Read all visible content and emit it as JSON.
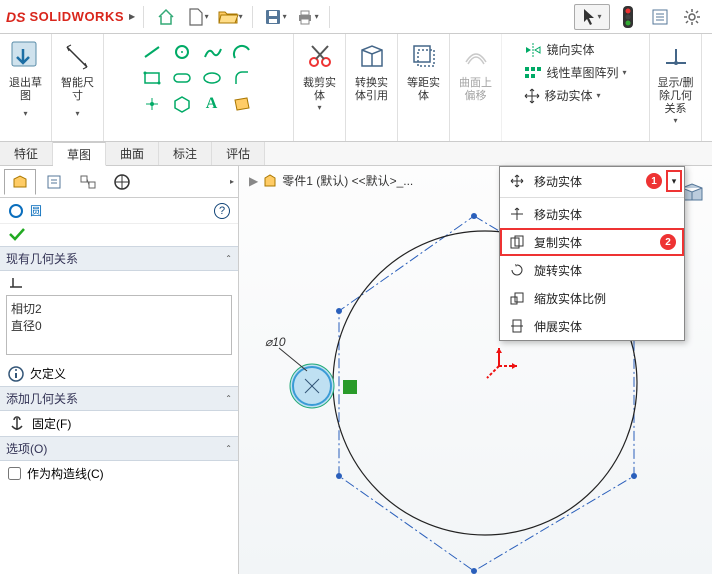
{
  "app": {
    "name": "SOLIDWORKS"
  },
  "ribbon": {
    "exit_sketch": "退出草\n图",
    "smart_dim": "智能尺\n寸",
    "trim": "裁剪实\n体",
    "convert": "转换实\n体引用",
    "offset": "等距实\n体",
    "curve_offset": "曲面上\n偏移",
    "mirror": "镜向实体",
    "linear_pattern": "线性草图阵列",
    "move_entity": "移动实体",
    "display_rel": "显示/删\n除几何\n关系"
  },
  "tabs": {
    "t1": "特征",
    "t2": "草图",
    "t3": "曲面",
    "t4": "标注",
    "t5": "评估"
  },
  "panel": {
    "title": "圆",
    "sec1": "现有几何关系",
    "rel1": "相切2",
    "rel2": "直径0",
    "underdef": "欠定义",
    "sec2": "添加几何关系",
    "fix": "固定(F)",
    "sec3": "选项(O)",
    "construction": "作为构造线(C)"
  },
  "breadcrumb": {
    "part": "零件1 (默认) <<默认>_..."
  },
  "menu": {
    "move": "移动实体",
    "move2": "移动实体",
    "copy": "复制实体",
    "rotate": "旋转实体",
    "scale": "缩放实体比例",
    "stretch": "伸展实体"
  },
  "dim": {
    "d1": "⌀10"
  }
}
